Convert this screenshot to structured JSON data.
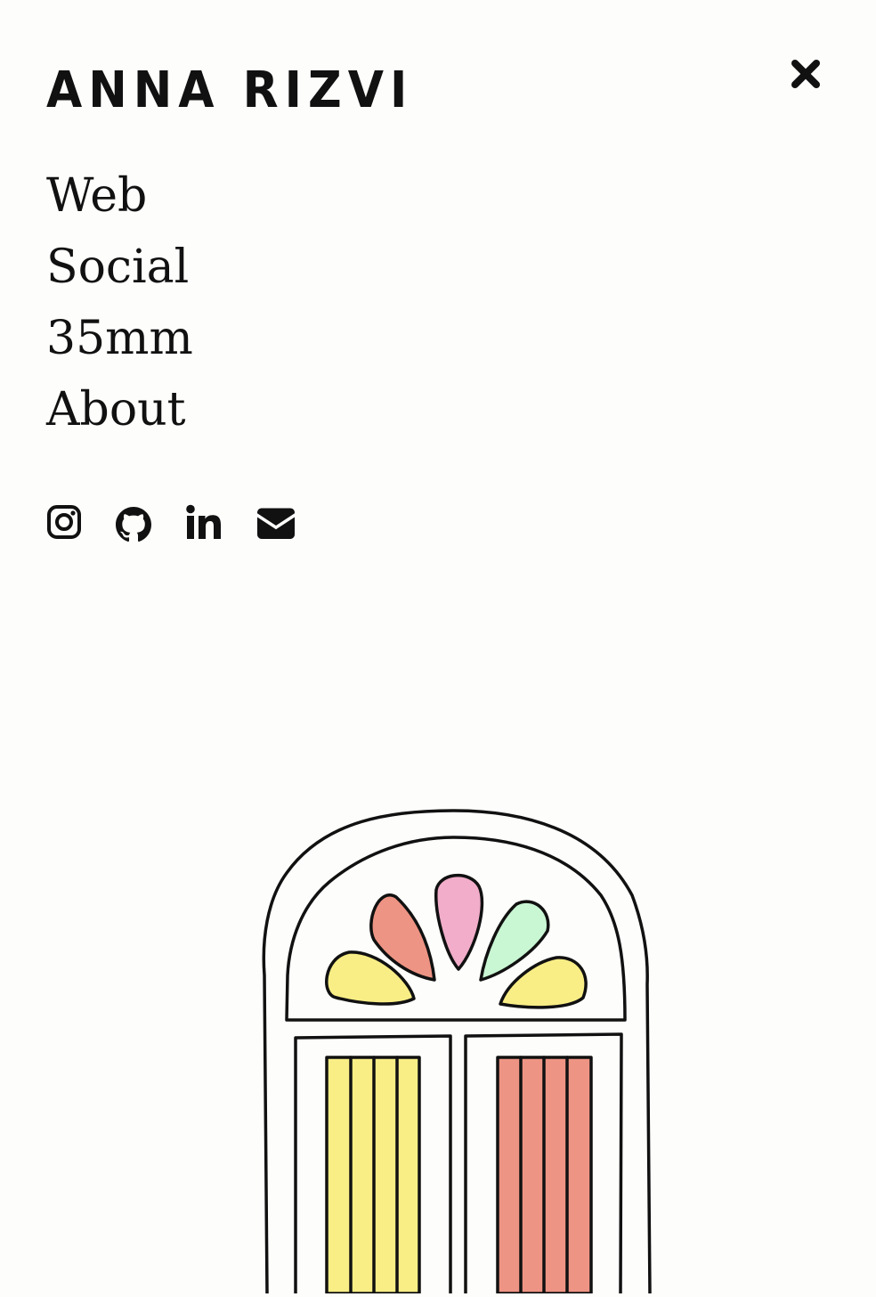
{
  "header": {
    "logo_text": "ANNA RIZVI",
    "close_icon": "close-icon"
  },
  "nav": {
    "items": [
      {
        "label": "Web"
      },
      {
        "label": "Social"
      },
      {
        "label": "35mm"
      },
      {
        "label": "About"
      }
    ]
  },
  "social": {
    "icons": [
      "instagram-icon",
      "github-icon",
      "linkedin-icon",
      "email-icon"
    ]
  },
  "illustration": {
    "subject": "arched-door-illustration",
    "colors": {
      "yellow": "#f9ee86",
      "salmon": "#ee9484",
      "pink": "#f1adc9",
      "mint": "#c9f6d3",
      "outline": "#111111",
      "background": "#fdfdfb"
    }
  }
}
